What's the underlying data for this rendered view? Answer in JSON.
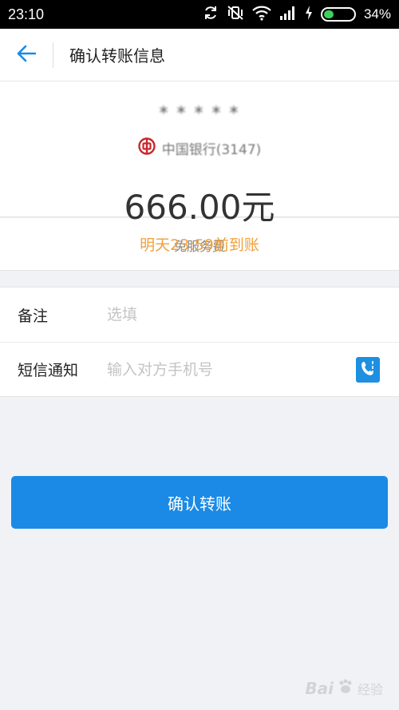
{
  "status_bar": {
    "time": "23:10",
    "battery_percent": "34%",
    "battery_level": 0.34,
    "icons": [
      "sync-icon",
      "vibrate-icon",
      "wifi-icon",
      "signal-icon",
      "charging-icon",
      "battery-icon"
    ]
  },
  "header": {
    "title": "确认转账信息",
    "back_icon": "arrow-left-icon"
  },
  "payee": {
    "name": "*  *  *  *  *",
    "bank_name": "中国银行(3147)",
    "bank_icon": "bank-of-china-logo",
    "amount": "666.00元",
    "fee_note": "免服务费"
  },
  "arrival": {
    "text": "明天23:59前到账"
  },
  "form": {
    "remark": {
      "label": "备注",
      "placeholder": "选填",
      "value": ""
    },
    "sms": {
      "label": "短信通知",
      "placeholder": "输入对方手机号",
      "value": "",
      "icon": "phone-contact-icon"
    }
  },
  "actions": {
    "confirm_label": "确认转账"
  },
  "watermark": {
    "text": "Bai",
    "sub": "经验"
  },
  "colors": {
    "accent": "#1a8ae6",
    "arrival": "#f0a03a",
    "bank_red": "#c8272e"
  }
}
